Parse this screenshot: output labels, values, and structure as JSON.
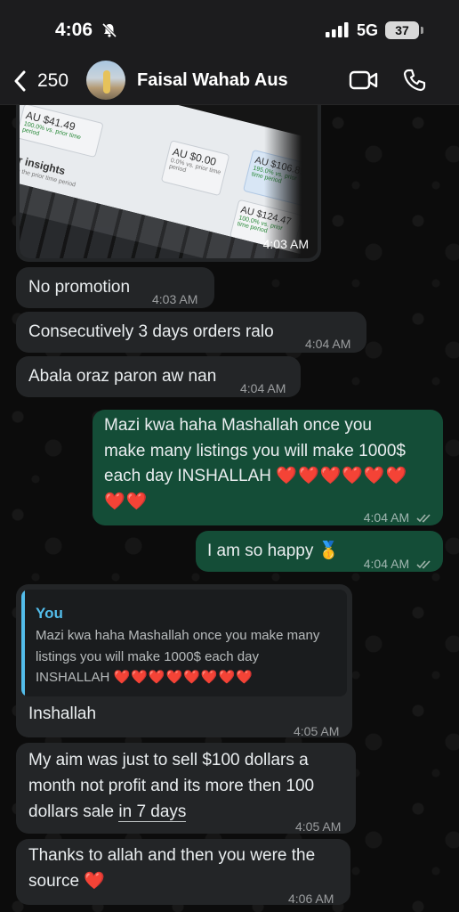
{
  "status_bar": {
    "time": "4:06",
    "network": "5G",
    "battery": "37"
  },
  "header": {
    "back_count": "250",
    "contact_name": "Faisal Wahab Aus"
  },
  "icons": {
    "back": "chevron-left-icon",
    "bell": "bell-slash-icon",
    "signal": "signal-bars-icon",
    "video": "video-camera-icon",
    "phone": "phone-icon",
    "read": "double-check-icon",
    "medal": "gold-medal-emoji"
  },
  "colors": {
    "incoming": "#232527",
    "outgoing": "#144d37",
    "quote_accent": "#53bdeb",
    "heart": "#e0242b"
  },
  "image_message": {
    "time": "4:03 AM",
    "screenshot_text": {
      "insights": "uyer insights",
      "insights_sub": "pared to the prior time period",
      "card1_value": "AU $41.49",
      "card1_delta": "100.0% vs. prior time period",
      "card2_value": "AU $0.00",
      "card2_delta": "0.0% vs. prior time period",
      "card3_value": "AU $106.89",
      "card3_delta": "195.0% vs. prior time period",
      "card4_value": "AU $124.47",
      "card4_delta": "100.0% vs. prior time period"
    }
  },
  "messages": [
    {
      "text": "No promotion",
      "time": "4:03 AM"
    },
    {
      "text": "Consecutively 3 days orders ralo",
      "time": "4:04 AM"
    },
    {
      "text": "Abala oraz paron aw nan",
      "time": "4:04 AM"
    },
    {
      "text_line1": "Mazi kwa haha Mashallah once you",
      "text_line2": "make many listings you will make 1000$",
      "text_line3": "each day INSHALLAH",
      "hearts_a": "❤️❤️❤️❤️❤️❤️",
      "hearts_b": "❤️❤️",
      "time": "4:04 AM"
    },
    {
      "text": "I am so happy",
      "emoji": "🥇",
      "time": "4:04 AM"
    },
    {
      "quote_author": "You",
      "quote_line1": "Mazi kwa haha Mashallah once you make many",
      "quote_line2": "listings you will make 1000$ each day",
      "quote_line3": "INSHALLAH",
      "quote_hearts": "❤️❤️❤️❤️❤️❤️❤️❤️",
      "text": "Inshallah",
      "time": "4:05 AM"
    },
    {
      "text_line1": "My aim was just to sell $100 dollars a",
      "text_line2": "month not profit and its more then 100",
      "text_line3a": "dollars sale ",
      "text_line3b": "in 7 days",
      "time": "4:05 AM"
    },
    {
      "text_line1": "Thanks to allah and then you were the",
      "text_line2": "source",
      "emoji": "❤️",
      "time": "4:06 AM"
    }
  ]
}
